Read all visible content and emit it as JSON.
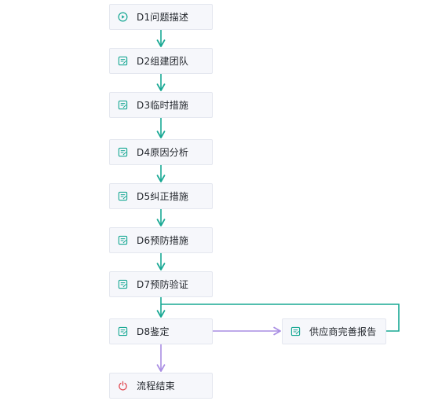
{
  "colors": {
    "main_flow": "#18a894",
    "branch_flow": "#a98ee3",
    "end_icon": "#e0424a",
    "node_bg": "#f6f7fb",
    "node_border": "#e4e7ef",
    "text": "#1f2329"
  },
  "nodes": [
    {
      "id": "d1",
      "label": "D1问题描述",
      "icon": "play-circle-icon"
    },
    {
      "id": "d2",
      "label": "D2组建团队",
      "icon": "form-icon"
    },
    {
      "id": "d3",
      "label": "D3临时措施",
      "icon": "form-icon"
    },
    {
      "id": "d4",
      "label": "D4原因分析",
      "icon": "form-icon"
    },
    {
      "id": "d5",
      "label": "D5纠正措施",
      "icon": "form-icon"
    },
    {
      "id": "d6",
      "label": "D6预防措施",
      "icon": "form-icon"
    },
    {
      "id": "d7",
      "label": "D7预防验证",
      "icon": "form-icon"
    },
    {
      "id": "d8",
      "label": "D8鉴定",
      "icon": "form-icon"
    },
    {
      "id": "supplier",
      "label": "供应商完善报告",
      "icon": "form-icon"
    },
    {
      "id": "end",
      "label": "流程结束",
      "icon": "power-icon"
    }
  ]
}
